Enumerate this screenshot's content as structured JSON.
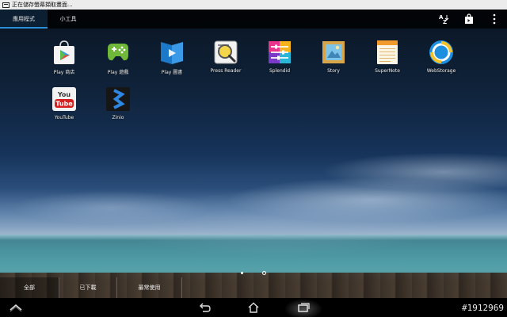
{
  "status_bar": {
    "notification_text": "正在儲存螢幕擷取畫面..."
  },
  "tabs": [
    {
      "label": "應用程式",
      "active": true
    },
    {
      "label": "小工具",
      "active": false
    }
  ],
  "header_actions": [
    "sort-az-icon",
    "shop-bag-icon",
    "overflow-menu-icon"
  ],
  "apps": [
    {
      "label": "Play 商店",
      "icon": "play-store-icon"
    },
    {
      "label": "Play 遊戲",
      "icon": "play-games-icon"
    },
    {
      "label": "Play 圖書",
      "icon": "play-books-icon"
    },
    {
      "label": "Press Reader",
      "icon": "press-reader-icon"
    },
    {
      "label": "Splendid",
      "icon": "splendid-icon"
    },
    {
      "label": "Story",
      "icon": "story-icon"
    },
    {
      "label": "SuperNote",
      "icon": "supernote-icon"
    },
    {
      "label": "WebStorage",
      "icon": "webstorage-icon"
    },
    {
      "label": "YouTube",
      "icon": "youtube-icon"
    },
    {
      "label": "Zinio",
      "icon": "zinio-icon"
    }
  ],
  "filters": [
    {
      "label": "全部",
      "active": true
    },
    {
      "label": "已下載",
      "active": false
    },
    {
      "label": "最常使用",
      "active": false
    }
  ],
  "page_indicator": {
    "current": 1,
    "total": 2
  },
  "nav": [
    "chevron-up-icon",
    "back-icon",
    "home-icon",
    "recents-icon"
  ],
  "watermark": "#1912969",
  "colors": {
    "accent": "#2a8fd6",
    "header_bg": "#000000",
    "status_bg": "#ececec"
  }
}
